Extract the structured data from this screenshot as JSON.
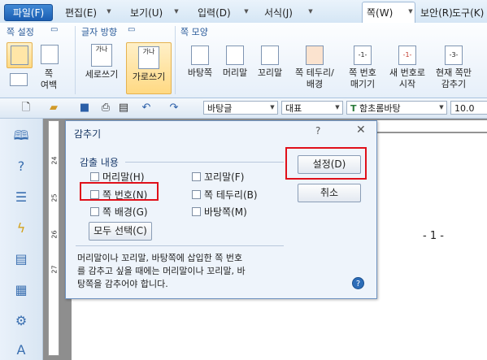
{
  "menubar": {
    "file": "파일(F)",
    "items": [
      "편집(E)",
      "보기(U)",
      "입력(D)",
      "서식(J)",
      "쪽(W)",
      "보안(R)",
      "도구(K)"
    ]
  },
  "ribbon": {
    "groups": {
      "page_setup": "쪽 설정",
      "text_direction": "글자 방향",
      "page_look": "쪽 모양"
    },
    "buttons": {
      "page_margin": "쪽\n여백",
      "vertical": "세로쓰기",
      "horizontal": "가로쓰기",
      "background": "바탕쪽",
      "header": "머리말",
      "footer": "꼬리말",
      "border": "쪽 테두리/\n배경",
      "page_number": "쪽 번호\n매기기",
      "new_number": "새 번호로\n시작",
      "hide_current": "현재 쪽만\n감추기"
    }
  },
  "toolbar": {
    "style": "바탕글",
    "lang": "대표",
    "font": "함초롬바탕",
    "size": "10.0"
  },
  "ruler": {
    "v_numbers": [
      "24",
      "25",
      "26",
      "27"
    ]
  },
  "document": {
    "page_number": "- 1 -"
  },
  "dialog": {
    "title": "감추기",
    "help": "?",
    "close": "✕",
    "section_label": "감출 내용",
    "checkboxes": {
      "header": "머리말(H)",
      "footer": "꼬리말(F)",
      "page_number": "쪽 번호(N)",
      "page_border": "쪽 테두리(B)",
      "page_background": "쪽 배경(G)",
      "master_page": "바탕쪽(M)"
    },
    "select_all": "모두 선택(C)",
    "set_button": "설정(D)",
    "cancel_button": "취소",
    "description": [
      "머리말이나 꼬리말, 바탕쪽에 삽입한 쪽 번호",
      "를 감추고 싶을 때에는 머리말이나 꼬리말, 바",
      "탕쪽을 감추어야 합니다."
    ]
  },
  "colors": {
    "highlight": "#e0101a",
    "dialog_bg": "#eef4fb",
    "accent": "#1b5fb3"
  }
}
